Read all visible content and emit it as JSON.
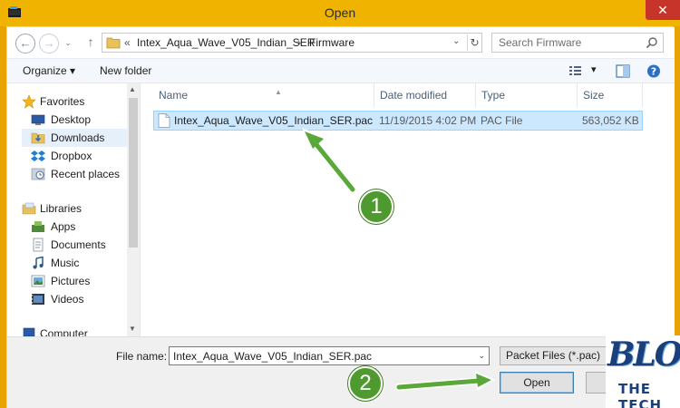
{
  "window": {
    "title": "Open",
    "close_glyph": "✕"
  },
  "navbar": {
    "back_glyph": "←",
    "forward_glyph": "→",
    "up_glyph": "↑",
    "crumb_prefix": "«",
    "crumbs": [
      "Intex_Aqua_Wave_V05_Indian_SER",
      "Firmware"
    ],
    "crumb_sep": "›",
    "dropdown_glyph": "⌄",
    "refresh_glyph": "↻",
    "search_placeholder": "Search Firmware"
  },
  "toolbar": {
    "organize_label": "Organize ▾",
    "new_folder_label": "New folder",
    "view_dropdown_glyph": "▾"
  },
  "navpane": {
    "favorites": "Favorites",
    "favorites_items": [
      "Desktop",
      "Downloads",
      "Dropbox",
      "Recent places"
    ],
    "libraries": "Libraries",
    "libraries_items": [
      "Apps",
      "Documents",
      "Music",
      "Pictures",
      "Videos"
    ],
    "computer": "Computer",
    "scroll_up": "▲",
    "scroll_down": "▼"
  },
  "filelist": {
    "columns": [
      "Name",
      "Date modified",
      "Type",
      "Size"
    ],
    "sort_glyph": "▲",
    "rows": [
      {
        "name": "Intex_Aqua_Wave_V05_Indian_SER.pac",
        "date": "11/19/2015 4:02 PM",
        "type": "PAC File",
        "size": "563,052 KB"
      }
    ]
  },
  "bottom": {
    "file_name_label": "File name:",
    "file_name_value": "Intex_Aqua_Wave_V05_Indian_SER.pac",
    "dropdown_glyph": "⌄",
    "file_type": "Packet Files (*.pac)",
    "open_label": "Open",
    "cancel_label": "C"
  },
  "annotations": {
    "step1": "1",
    "step2": "2",
    "color": "#4f9a2e"
  },
  "watermark": {
    "line1": "BLOG",
    "line2": "THE TECH"
  }
}
